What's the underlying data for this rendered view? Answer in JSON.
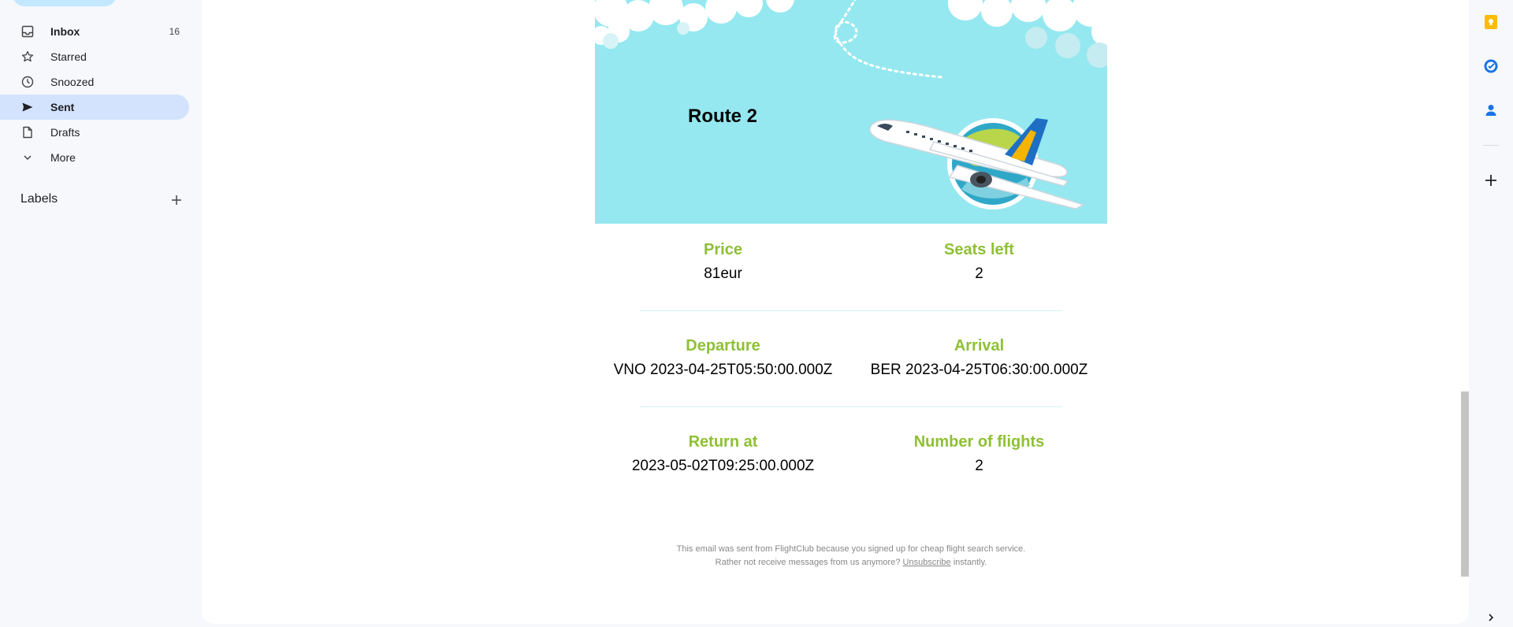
{
  "sidebar": {
    "items": [
      {
        "label": "Inbox",
        "count": "16",
        "icon": "inbox-icon"
      },
      {
        "label": "Starred",
        "icon": "star-icon"
      },
      {
        "label": "Snoozed",
        "icon": "clock-icon"
      },
      {
        "label": "Sent",
        "icon": "send-icon",
        "active": true
      },
      {
        "label": "Drafts",
        "icon": "draft-icon"
      },
      {
        "label": "More",
        "icon": "chevron-down-icon"
      }
    ],
    "labels_title": "Labels"
  },
  "email": {
    "route_title": "Route 2",
    "fields": {
      "price_label": "Price",
      "price_value": "81eur",
      "seats_label": "Seats left",
      "seats_value": "2",
      "departure_label": "Departure",
      "departure_value": "VNO 2023-04-25T05:50:00.000Z",
      "arrival_label": "Arrival",
      "arrival_value": "BER 2023-04-25T06:30:00.000Z",
      "return_label": "Return at",
      "return_value": "2023-05-02T09:25:00.000Z",
      "flights_label": "Number of flights",
      "flights_value": "2"
    },
    "footer": {
      "line1": "This email was sent from FlightClub because you signed up for cheap flight search service.",
      "line2_prefix": "Rather not receive messages from us anymore?",
      "unsubscribe": "Unsubscribe",
      "line2_suffix": "instantly."
    }
  },
  "rightbar": {
    "icons": [
      "keep-icon",
      "tasks-icon",
      "contacts-icon",
      "add-icon",
      "chevron-right-icon"
    ]
  },
  "colors": {
    "hero_bg": "#95e8f0",
    "field_label": "#8ec035",
    "sent_active_bg": "#d3e3fd",
    "keep_yellow": "#fbbc04",
    "tasks_blue": "#1a73e8"
  }
}
